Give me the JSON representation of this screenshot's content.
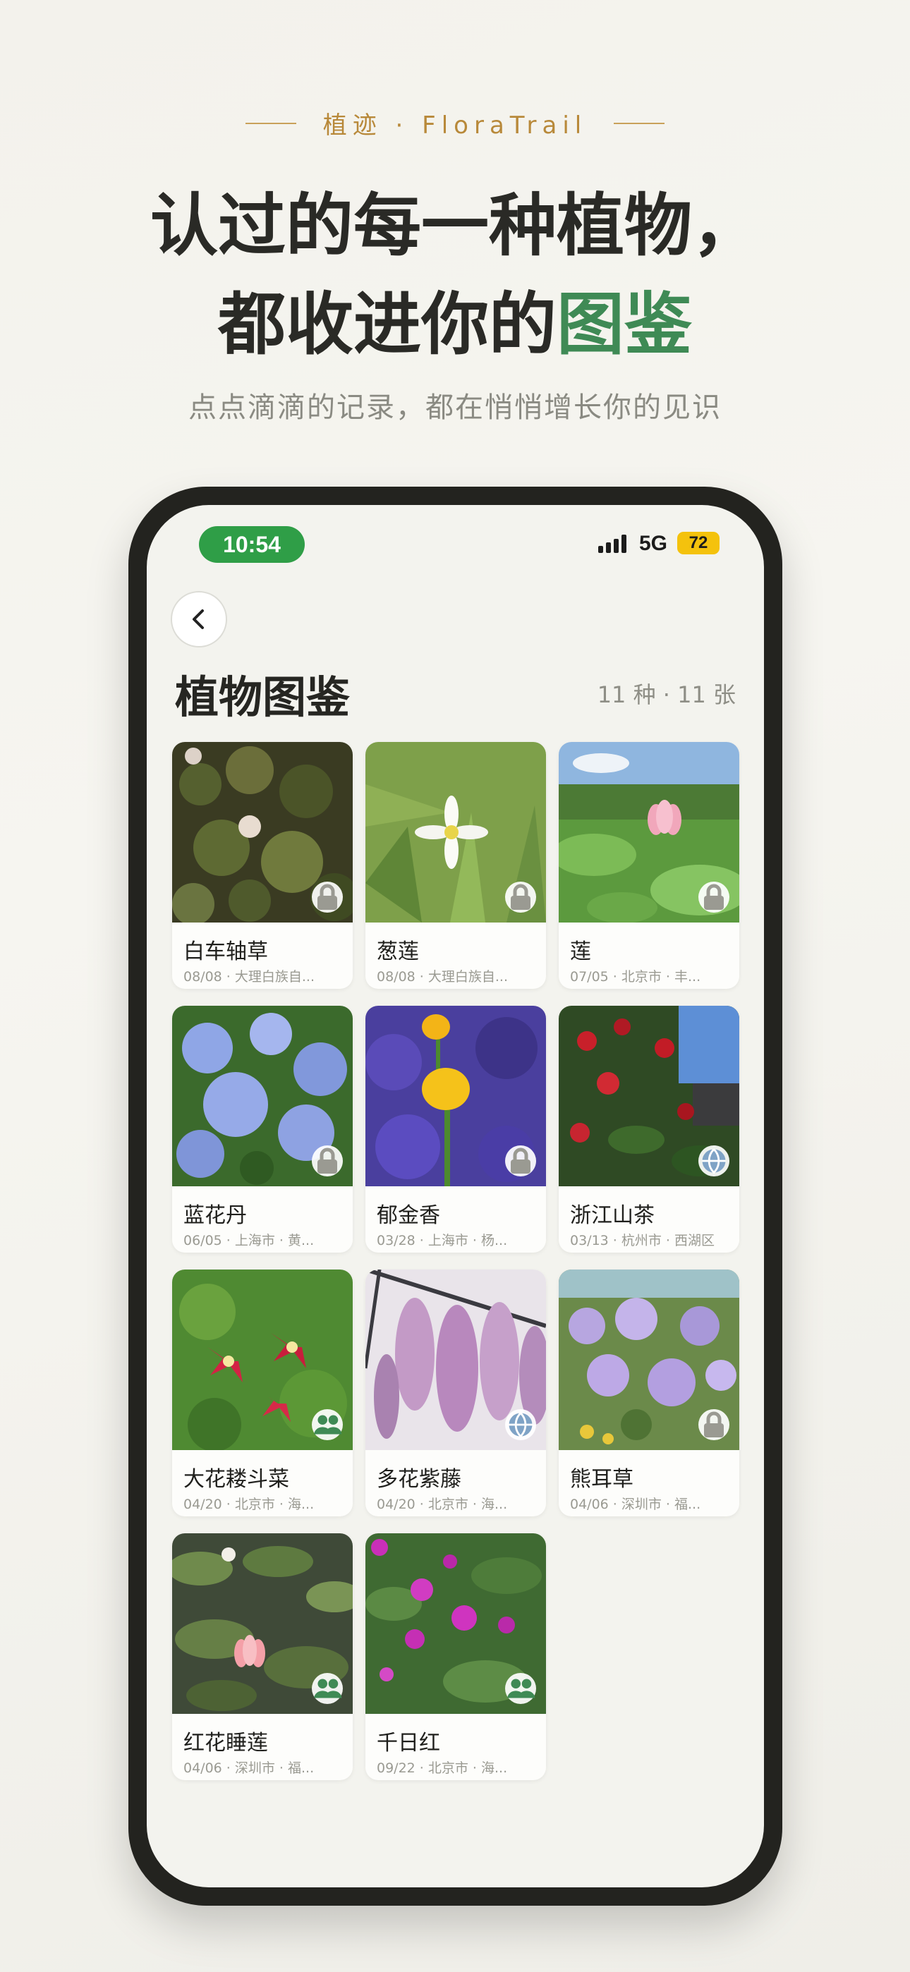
{
  "brand": {
    "text": "植迹 · FloraTrail"
  },
  "headline": {
    "line1": "认过的每一种植物，",
    "line2_prefix": "都收进你的",
    "line2_accent": "图鉴"
  },
  "subline": "点点滴滴的记录，都在悄悄增长你的见识",
  "colors": {
    "accent_green": "#3f8a55",
    "brand_gold": "#b8893a",
    "time_pill": "#2f9e47",
    "battery": "#f4c20d"
  },
  "status": {
    "time": "10:54",
    "network": "5G",
    "battery": "72"
  },
  "header": {
    "title": "植物图鉴",
    "count": "11 种 · 11 张"
  },
  "plants": [
    {
      "name": "白车轴草",
      "meta": "08/08 · 大理白族自...",
      "visibility_icon": "lock-icon"
    },
    {
      "name": "葱莲",
      "meta": "08/08 · 大理白族自...",
      "visibility_icon": "lock-icon"
    },
    {
      "name": "莲",
      "meta": "07/05 · 北京市 · 丰...",
      "visibility_icon": "lock-icon"
    },
    {
      "name": "蓝花丹",
      "meta": "06/05 · 上海市 · 黄...",
      "visibility_icon": "lock-icon"
    },
    {
      "name": "郁金香",
      "meta": "03/28 · 上海市 · 杨...",
      "visibility_icon": "lock-icon"
    },
    {
      "name": "浙江山茶",
      "meta": "03/13 · 杭州市 · 西湖区",
      "visibility_icon": "globe-icon"
    },
    {
      "name": "大花耧斗菜",
      "meta": "04/20 · 北京市 · 海...",
      "visibility_icon": "people-icon"
    },
    {
      "name": "多花紫藤",
      "meta": "04/20 · 北京市 · 海...",
      "visibility_icon": "globe-icon"
    },
    {
      "name": "熊耳草",
      "meta": "04/06 · 深圳市 · 福...",
      "visibility_icon": "lock-icon"
    },
    {
      "name": "红花睡莲",
      "meta": "04/06 · 深圳市 · 福...",
      "visibility_icon": "people-icon"
    },
    {
      "name": "千日红",
      "meta": "09/22 · 北京市 · 海...",
      "visibility_icon": "people-icon"
    }
  ]
}
